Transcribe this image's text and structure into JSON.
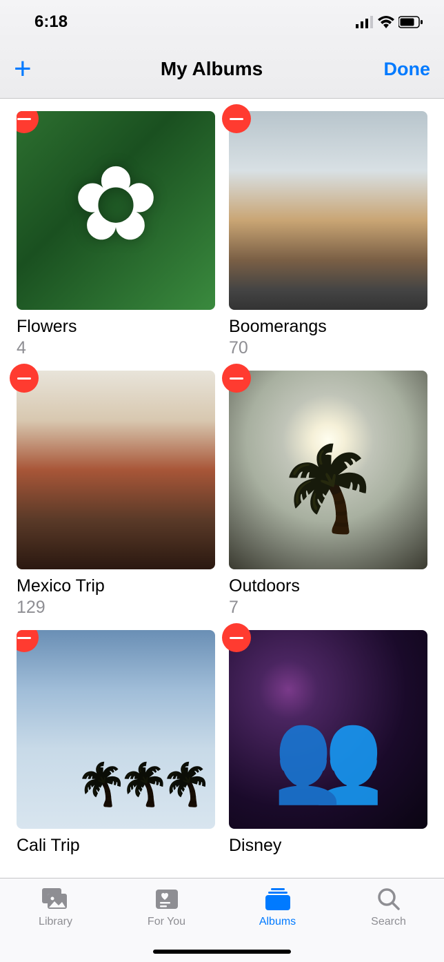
{
  "status_bar": {
    "time": "6:18"
  },
  "nav": {
    "title": "My Albums",
    "done_label": "Done"
  },
  "albums": [
    {
      "name": "Flowers",
      "count": "4"
    },
    {
      "name": "Boomerangs",
      "count": "70"
    },
    {
      "name": "Mexico Trip",
      "count": "129"
    },
    {
      "name": "Outdoors",
      "count": "7"
    },
    {
      "name": "Cali Trip",
      "count": ""
    },
    {
      "name": "Disney",
      "count": ""
    }
  ],
  "tabs": [
    {
      "label": "Library"
    },
    {
      "label": "For You"
    },
    {
      "label": "Albums"
    },
    {
      "label": "Search"
    }
  ],
  "active_tab": "Albums"
}
